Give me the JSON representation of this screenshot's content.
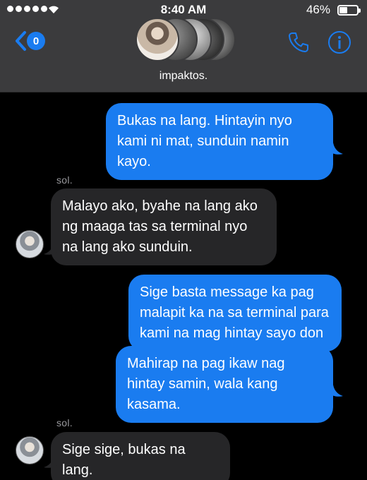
{
  "status_bar": {
    "time": "8:40 AM",
    "battery_percent": "46%",
    "battery_level": 0.46,
    "signal_bars": 5
  },
  "header": {
    "back_badge_count": "0",
    "group_name": "impaktos.",
    "accent_color": "#1a7cf0"
  },
  "messages": [
    {
      "direction": "outgoing",
      "text": "Bukas na lang. Hintayin nyo kami ni mat, sunduin namin kayo."
    },
    {
      "direction": "incoming",
      "sender": "sol.",
      "text": "Malayo ako, byahe na lang ako ng maaga tas sa terminal nyo na lang ako sunduin."
    },
    {
      "direction": "outgoing",
      "text": "Sige basta message ka pag malapit ka na sa terminal para kami na mag hintay sayo don"
    },
    {
      "direction": "outgoing",
      "text": "Mahirap na pag ikaw nag hintay samin, wala kang kasama."
    },
    {
      "direction": "incoming",
      "sender": "sol.",
      "text": "Sige sige, bukas na lang."
    }
  ]
}
